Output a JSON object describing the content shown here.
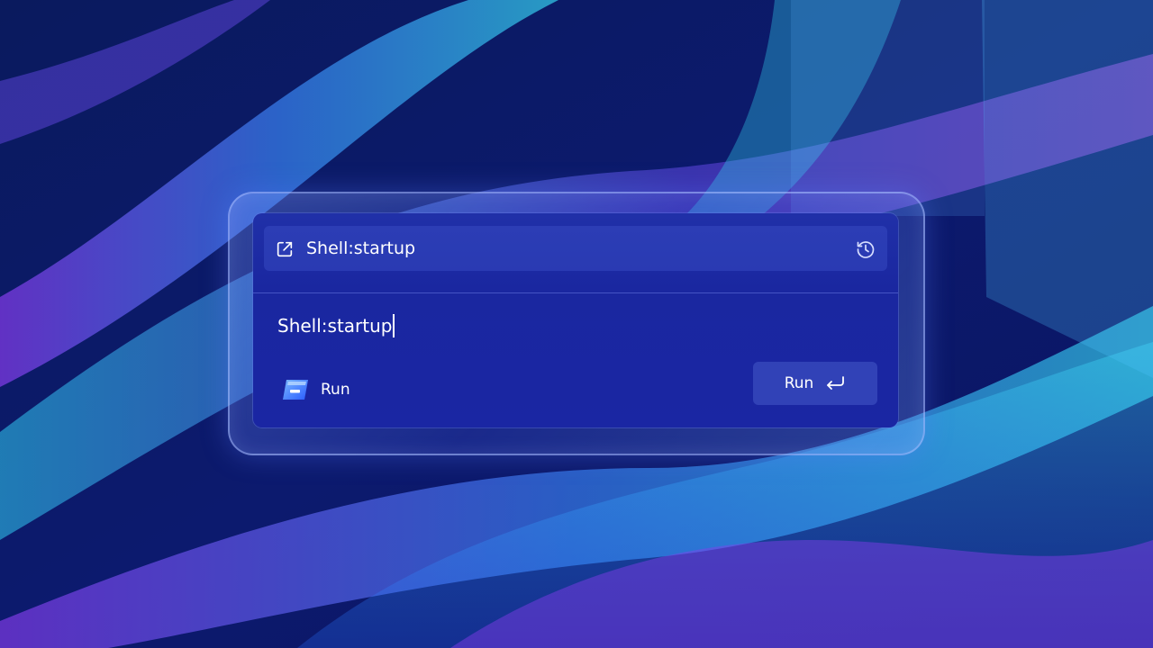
{
  "search": {
    "query": "Shell:startup"
  },
  "command": {
    "value": "Shell:startup"
  },
  "app": {
    "name": "Run"
  },
  "actions": {
    "run_label": "Run"
  },
  "icons": {
    "open_external": "open-external-icon",
    "history": "history-icon",
    "app": "run-app-icon",
    "enter": "enter-key-icon"
  },
  "colors": {
    "dialog_bg": "#1a27a0",
    "accent": "#3b6cff",
    "text": "#ffffff"
  }
}
